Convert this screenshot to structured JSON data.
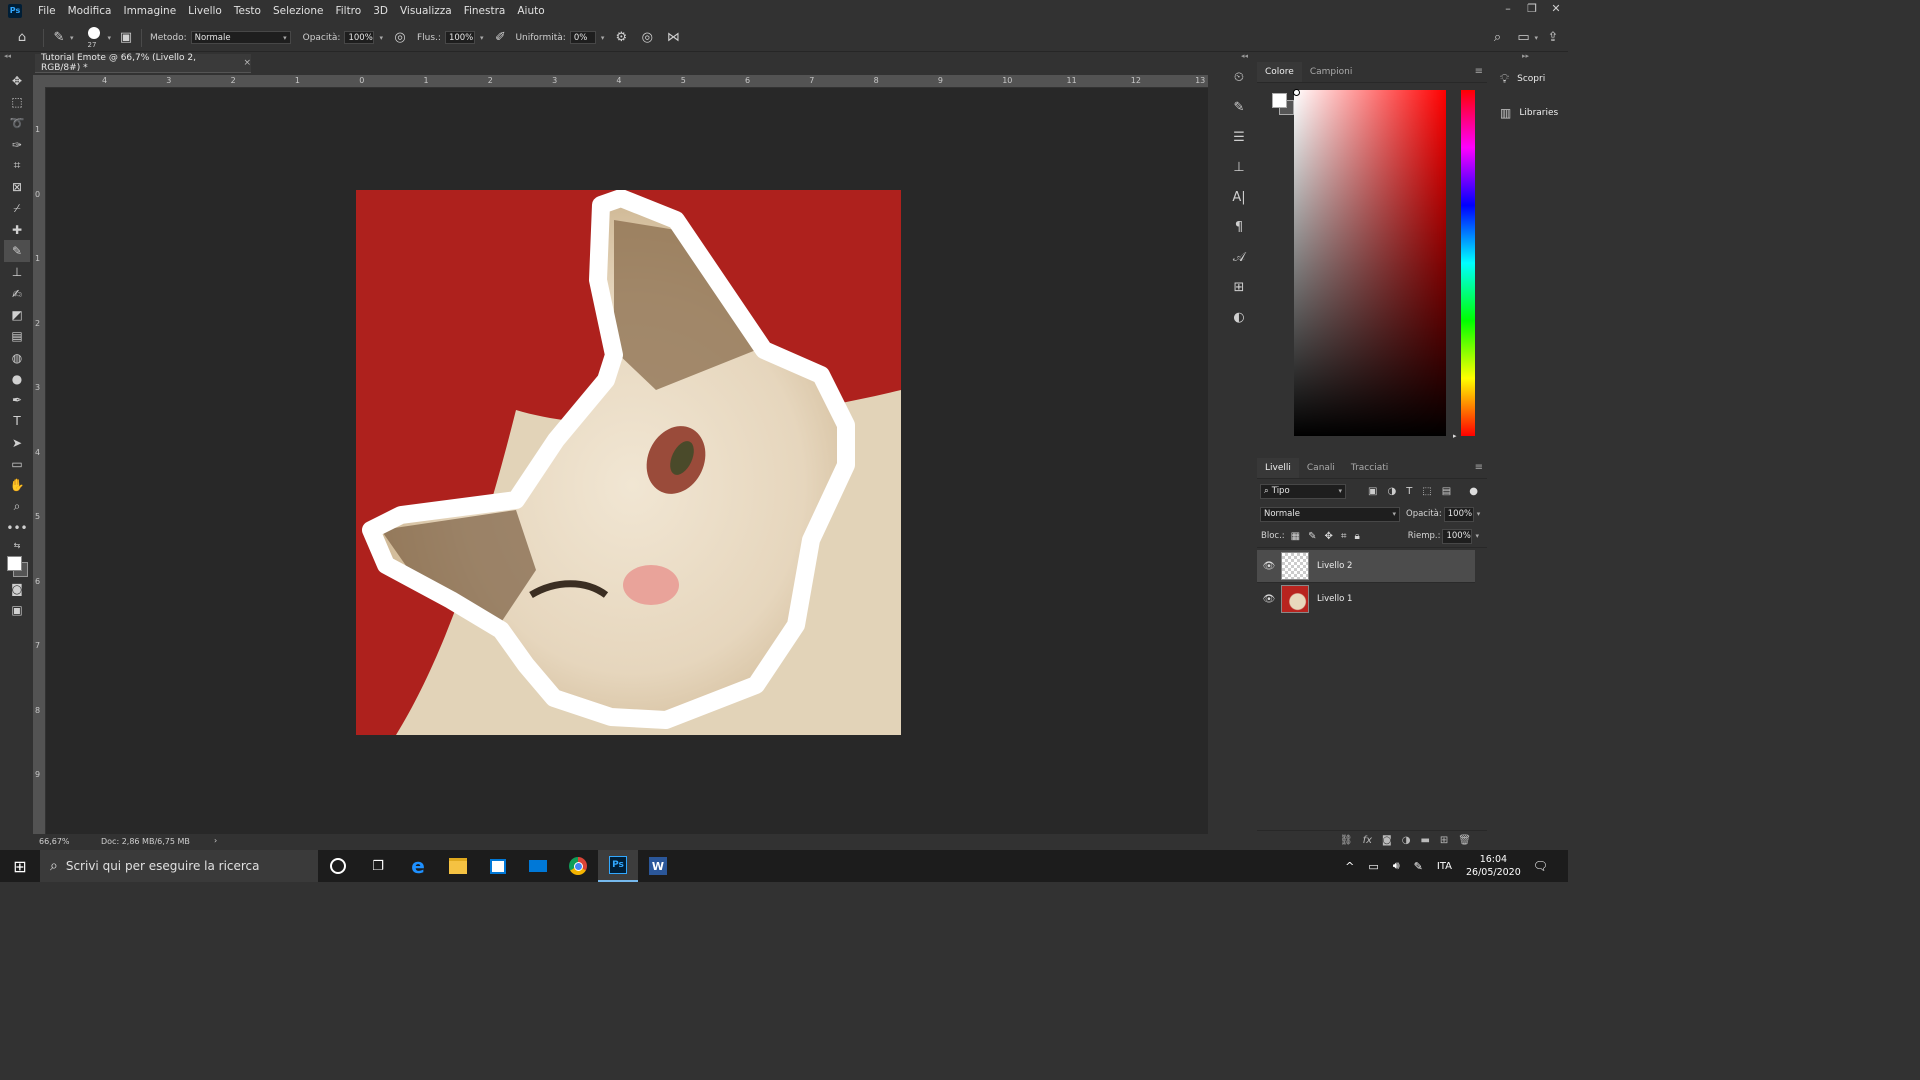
{
  "app": {
    "logo": "Ps"
  },
  "menu": [
    "File",
    "Modifica",
    "Immagine",
    "Livello",
    "Testo",
    "Selezione",
    "Filtro",
    "3D",
    "Visualizza",
    "Finestra",
    "Aiuto"
  ],
  "window_controls": [
    "–",
    "❐",
    "✕"
  ],
  "options": {
    "brush_size": "27",
    "method_label": "Metodo:",
    "method_value": "Normale",
    "opacity_label": "Opacità:",
    "opacity_value": "100%",
    "flow_label": "Flus.:",
    "flow_value": "100%",
    "smoothing_label": "Uniformità:",
    "smoothing_value": "0%"
  },
  "document": {
    "tab_title": "Tutorial Emote @ 66,7% (Livello 2, RGB/8#) *",
    "close": "×",
    "zoom": "66,67%",
    "doc_info": "Doc: 2,86 MB/6,75 MB",
    "status_arrow": "›"
  },
  "ruler": {
    "h": [
      "4",
      "3",
      "2",
      "1",
      "0",
      "1",
      "2",
      "3",
      "4",
      "5",
      "6",
      "7",
      "8",
      "9",
      "10",
      "11",
      "12",
      "13"
    ],
    "v": [
      "1",
      "0",
      "1",
      "2",
      "3",
      "4",
      "5",
      "6",
      "7",
      "8",
      "9"
    ]
  },
  "color_panel": {
    "tabs": [
      "Colore",
      "Campioni"
    ],
    "foreground": "#ffffff",
    "hue": "#ff0000"
  },
  "layers_panel": {
    "tabs": [
      "Livelli",
      "Canali",
      "Tracciati"
    ],
    "filter": "Tipo",
    "blend": "Normale",
    "opacity_label": "Opacità:",
    "opacity_value": "100%",
    "lock_label": "Bloc.:",
    "fill_label": "Riemp.:",
    "fill_value": "100%",
    "layers": [
      {
        "name": "Livello 2",
        "selected": true
      },
      {
        "name": "Livello 1",
        "selected": false
      }
    ]
  },
  "side_panel": {
    "items": [
      "Scopri",
      "Libraries"
    ]
  },
  "taskbar": {
    "search_placeholder": "Scrivi qui per eseguire la ricerca",
    "lang": "ITA",
    "time": "16:04",
    "date": "26/05/2020"
  }
}
